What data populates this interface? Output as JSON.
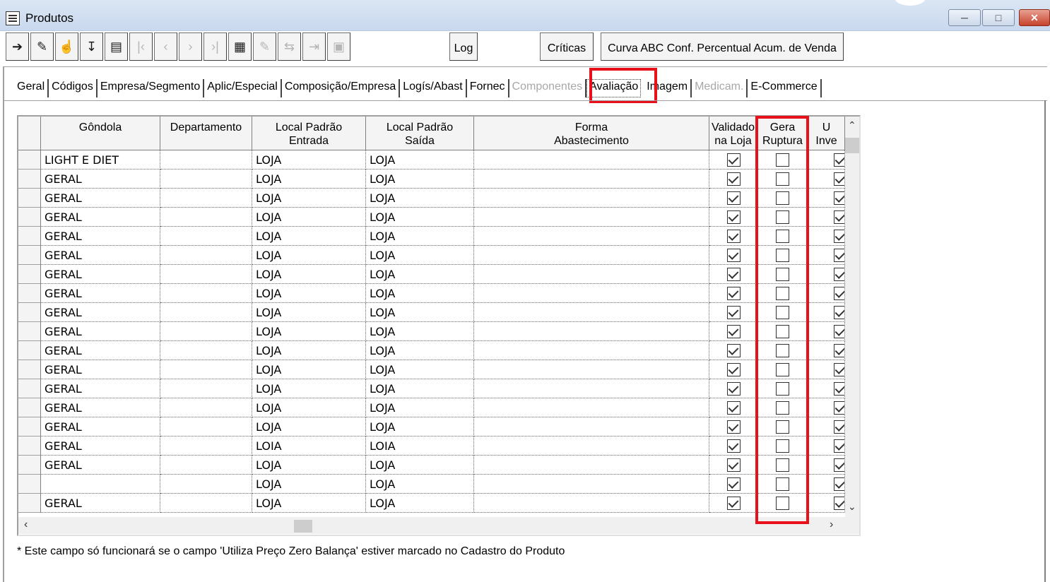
{
  "window": {
    "title": "Produtos"
  },
  "toolbar": {
    "icons": [
      "exit-icon",
      "eraser-icon",
      "edit-icon",
      "download-icon",
      "print-icon",
      "first-icon",
      "prev-icon",
      "next-icon",
      "last-icon",
      "sheet-icon",
      "doc-icon",
      "move-icon",
      "export-icon",
      "image-icon"
    ],
    "log_label": "Log",
    "criticas_label": "Críticas",
    "curva_label": "Curva ABC Conf. Percentual Acum. de Venda"
  },
  "tabs": [
    {
      "label": "Geral",
      "state": "normal"
    },
    {
      "label": "Códigos",
      "state": "normal"
    },
    {
      "label": "Empresa/Segmento",
      "state": "normal"
    },
    {
      "label": "Aplic/Especial",
      "state": "normal"
    },
    {
      "label": "Composição/Empresa",
      "state": "normal"
    },
    {
      "label": "Logís/Abast",
      "state": "normal"
    },
    {
      "label": "Fornec",
      "state": "normal"
    },
    {
      "label": "Componentes",
      "state": "disabled"
    },
    {
      "label": "Avaliação",
      "state": "active"
    },
    {
      "label": "Imagem",
      "state": "normal"
    },
    {
      "label": "Medicam.",
      "state": "disabled"
    },
    {
      "label": "E-Commerce",
      "state": "normal"
    }
  ],
  "grid": {
    "columns": [
      {
        "label": "Gôndola"
      },
      {
        "label": "Departamento"
      },
      {
        "label": "Local Padrão\nEntrada"
      },
      {
        "label": "Local Padrão\nSaída"
      },
      {
        "label": "Forma\nAbastecimento"
      },
      {
        "label": "Validado\nna Loja"
      },
      {
        "label": "Gera\nRuptura"
      },
      {
        "label": "U\nInve"
      }
    ],
    "rows": [
      {
        "gondola": "LIGHT E DIET",
        "departamento": "",
        "entrada": "LOJA",
        "saida": "LOJA",
        "forma": "",
        "validado": true,
        "ruptura": false
      },
      {
        "gondola": "GERAL",
        "departamento": "",
        "entrada": "LOJA",
        "saida": "LOJA",
        "forma": "",
        "validado": true,
        "ruptura": false
      },
      {
        "gondola": "GERAL",
        "departamento": "",
        "entrada": "LOJA",
        "saida": "LOJA",
        "forma": "",
        "validado": true,
        "ruptura": false
      },
      {
        "gondola": "GERAL",
        "departamento": "",
        "entrada": "LOJA",
        "saida": "LOJA",
        "forma": "",
        "validado": true,
        "ruptura": false
      },
      {
        "gondola": "GERAL",
        "departamento": "",
        "entrada": "LOJA",
        "saida": "LOJA",
        "forma": "",
        "validado": true,
        "ruptura": false
      },
      {
        "gondola": "GERAL",
        "departamento": "",
        "entrada": "LOJA",
        "saida": "LOJA",
        "forma": "",
        "validado": true,
        "ruptura": false
      },
      {
        "gondola": "GERAL",
        "departamento": "",
        "entrada": "LOJA",
        "saida": "LOJA",
        "forma": "",
        "validado": true,
        "ruptura": false
      },
      {
        "gondola": "GERAL",
        "departamento": "",
        "entrada": "LOJA",
        "saida": "LOJA",
        "forma": "",
        "validado": true,
        "ruptura": false
      },
      {
        "gondola": "GERAL",
        "departamento": "",
        "entrada": "LOJA",
        "saida": "LOJA",
        "forma": "",
        "validado": true,
        "ruptura": false
      },
      {
        "gondola": "GERAL",
        "departamento": "",
        "entrada": "LOJA",
        "saida": "LOJA",
        "forma": "",
        "validado": true,
        "ruptura": false
      },
      {
        "gondola": "GERAL",
        "departamento": "",
        "entrada": "LOJA",
        "saida": "LOJA",
        "forma": "",
        "validado": true,
        "ruptura": false
      },
      {
        "gondola": "GERAL",
        "departamento": "",
        "entrada": "LOJA",
        "saida": "LOJA",
        "forma": "",
        "validado": true,
        "ruptura": false
      },
      {
        "gondola": "GERAL",
        "departamento": "",
        "entrada": "LOJA",
        "saida": "LOJA",
        "forma": "",
        "validado": true,
        "ruptura": false
      },
      {
        "gondola": "GERAL",
        "departamento": "",
        "entrada": "LOJA",
        "saida": "LOJA",
        "forma": "",
        "validado": true,
        "ruptura": false
      },
      {
        "gondola": "GERAL",
        "departamento": "",
        "entrada": "LOJA",
        "saida": "LOJA",
        "forma": "",
        "validado": true,
        "ruptura": false
      },
      {
        "gondola": "GERAL",
        "departamento": "",
        "entrada": "LOIA",
        "saida": "LOIA",
        "forma": "",
        "validado": true,
        "ruptura": false
      },
      {
        "gondola": "GERAL",
        "departamento": "",
        "entrada": "LOJA",
        "saida": "LOJA",
        "forma": "",
        "validado": true,
        "ruptura": false
      },
      {
        "gondola": "",
        "departamento": "",
        "entrada": "LOJA",
        "saida": "LOJA",
        "forma": "",
        "validado": true,
        "ruptura": false
      },
      {
        "gondola": "GERAL",
        "departamento": "",
        "entrada": "LOJA",
        "saida": "LOJA",
        "forma": "",
        "validado": true,
        "ruptura": false
      }
    ]
  },
  "footnote": "* Este campo só funcionará se o campo 'Utiliza Preço Zero Balança' estiver marcado no Cadastro do Produto",
  "colors": {
    "highlight": "#e8101a",
    "titlebar": "#c9d9ee"
  }
}
